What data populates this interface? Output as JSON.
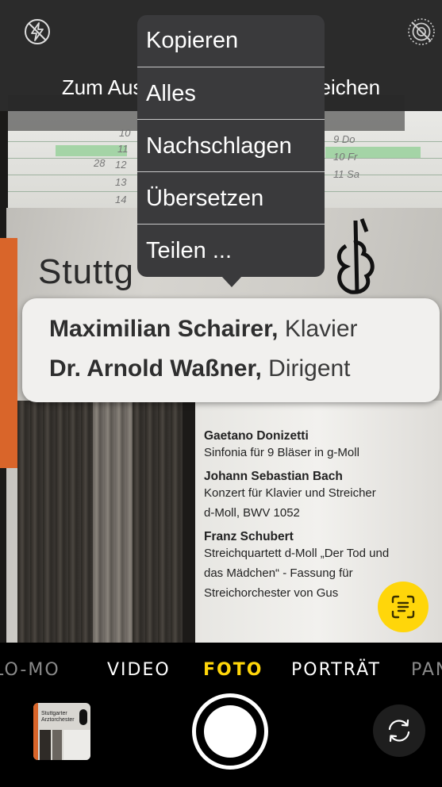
{
  "camera": {
    "hint_text": "Zum Auswählen von Text streichen",
    "icons": {
      "flash": "flash-off-icon",
      "live_photo": "live-photo-off-icon",
      "live_text": "live-text-icon",
      "flip": "camera-flip-icon",
      "thumbnail": "last-photo-thumbnail"
    },
    "accent_color": "#ffd60a"
  },
  "context_menu": {
    "items": [
      {
        "label": "Kopieren"
      },
      {
        "label": "Alles"
      },
      {
        "label": "Nachschlagen"
      },
      {
        "label": "Übersetzen"
      },
      {
        "label": "Teilen ..."
      }
    ]
  },
  "loupe": {
    "line1_bold": "Maximilian Schairer,",
    "line1_rest": " Klavier",
    "line2_bold": "Dr. Arnold Waßner,",
    "line2_rest": " Dirigent"
  },
  "poster": {
    "heading_fragment": "Stuttg",
    "program": [
      {
        "composer": "Gaetano Donizetti",
        "work": [
          "Sinfonia für 9 Bläser in g-Moll"
        ]
      },
      {
        "composer": "Johann Sebastian Bach",
        "work": [
          "Konzert für Klavier und Streicher",
          "d-Moll, BWV 1052"
        ]
      },
      {
        "composer": "Franz Schubert",
        "work": [
          "Streichquartett d-Moll „Der Tod und",
          "das Mädchen“ - Fassung für",
          "Streichorchester von Gus"
        ]
      }
    ],
    "calendar_numbers": [
      "10",
      "11",
      "28",
      "12",
      "13",
      "14",
      "9 Do",
      "10 Fr",
      "11 Sa"
    ]
  },
  "modes": {
    "items": [
      {
        "label": "LO-MO",
        "state": "faded"
      },
      {
        "label": "VIDEO",
        "state": "normal"
      },
      {
        "label": "FOTO",
        "state": "active"
      },
      {
        "label": "PORTRÄT",
        "state": "normal"
      },
      {
        "label": "PAN",
        "state": "faded"
      }
    ]
  },
  "thumbnail_text": [
    "Stuttgarter",
    "Arztorchester"
  ]
}
